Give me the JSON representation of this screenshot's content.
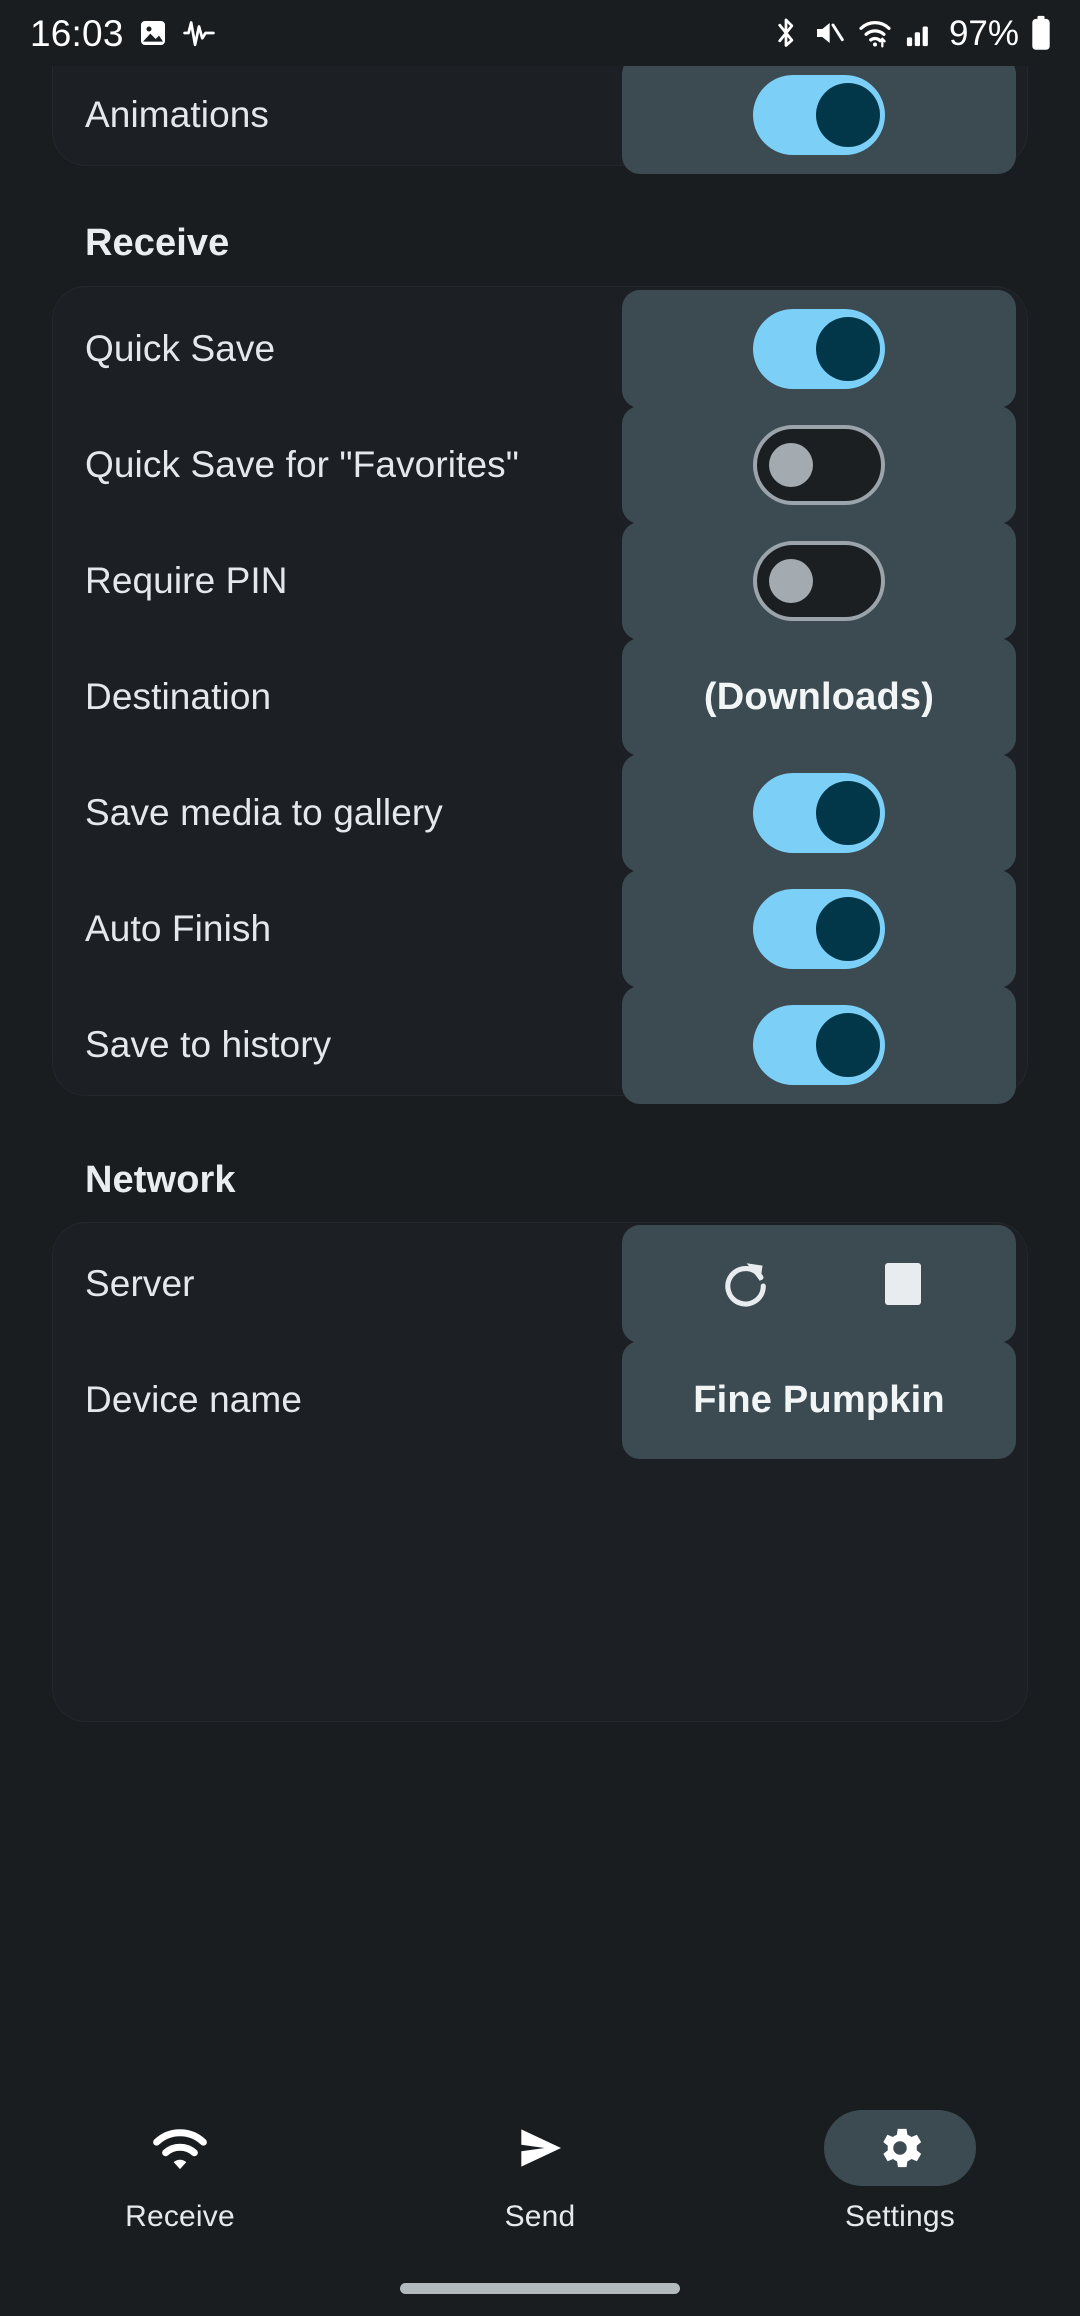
{
  "statusbar": {
    "clock": "16:03",
    "battery_text": "97%",
    "left_icons": [
      "photo-icon",
      "pulse-icon"
    ],
    "right_icons": [
      "bluetooth-icon",
      "mute-icon",
      "wifi-icon",
      "signal-icon",
      "battery-icon"
    ]
  },
  "theme": {
    "background": "#191d20",
    "card_background": "#1c2024",
    "control_background": "#3c4a52",
    "accent_on": "#7cd0f7",
    "knob_on": "#02374a",
    "knob_off": "#a3abb1",
    "text_primary": "#e6eaec"
  },
  "partial_top_row": {
    "label": "Animations",
    "control": "toggle",
    "state": "on"
  },
  "sections": [
    {
      "title": "Receive",
      "rows": [
        {
          "label": "Quick Save",
          "control": "toggle",
          "state": "on"
        },
        {
          "label": "Quick Save for \"Favorites\"",
          "control": "toggle",
          "state": "off"
        },
        {
          "label": "Require PIN",
          "control": "toggle",
          "state": "off"
        },
        {
          "label": "Destination",
          "control": "value",
          "value": "(Downloads)"
        },
        {
          "label": "Save media to gallery",
          "control": "toggle",
          "state": "on"
        },
        {
          "label": "Auto Finish",
          "control": "toggle",
          "state": "on"
        },
        {
          "label": "Save to history",
          "control": "toggle",
          "state": "on"
        }
      ]
    },
    {
      "title": "Network",
      "rows": [
        {
          "label": "Server",
          "control": "buttons",
          "buttons": [
            "restart-icon",
            "stop-icon"
          ]
        },
        {
          "label": "Device name",
          "control": "value",
          "value": "Fine Pumpkin"
        }
      ]
    }
  ],
  "bottomnav": {
    "items": [
      {
        "label": "Receive",
        "icon": "wifi-icon",
        "active": false
      },
      {
        "label": "Send",
        "icon": "send-icon",
        "active": false
      },
      {
        "label": "Settings",
        "icon": "gear-icon",
        "active": true
      }
    ]
  }
}
